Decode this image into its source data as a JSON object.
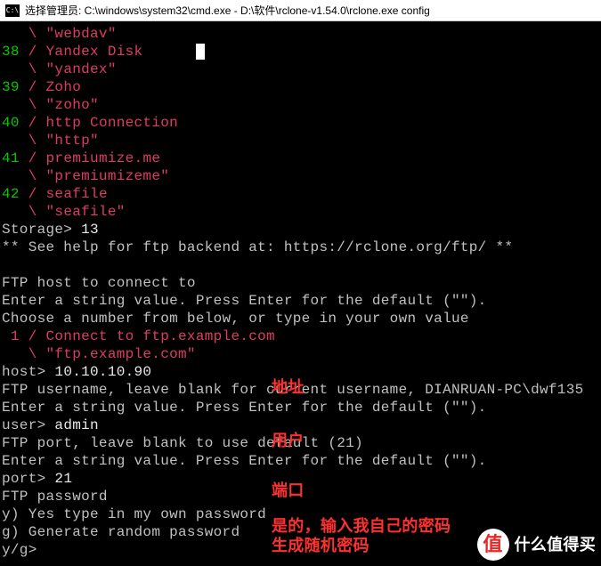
{
  "window": {
    "title": "选择管理员: C:\\windows\\system32\\cmd.exe - D:\\软件\\rclone-v1.54.0\\rclone.exe  config"
  },
  "items": [
    {
      "index": "  ",
      "name": "",
      "key": "webdav"
    },
    {
      "index": "38",
      "name": "Yandex Disk",
      "key": "yandex"
    },
    {
      "index": "39",
      "name": "Zoho",
      "key": "zoho"
    },
    {
      "index": "40",
      "name": "http Connection",
      "key": "http"
    },
    {
      "index": "41",
      "name": "premiumize.me",
      "key": "premiumizeme"
    },
    {
      "index": "42",
      "name": "seafile",
      "key": "seafile"
    }
  ],
  "prompts": {
    "storage_label": "Storage> ",
    "storage_value": "13",
    "help_line": "** See help for ftp backend at: https://rclone.org/ftp/ **",
    "host_header": "FTP host to connect to",
    "enter_string": "Enter a string value. Press Enter for the default (\"\").",
    "choose_num": "Choose a number from below, or type in your own value",
    "example_connect": " 1 / Connect to ftp.example.com",
    "example_key": "   \\ \"ftp.example.com\"",
    "host_label": "host> ",
    "host_value": "10.10.10.90",
    "user_line": "FTP username, leave blank for current username, DIANRUAN-PC\\dwf135",
    "user_label": "user> ",
    "user_value": "admin",
    "port_line": "FTP port, leave blank to use default (21)",
    "port_label": "port> ",
    "port_value": "21",
    "pass_header": "FTP password",
    "opt_y": "y) Yes type in my own password",
    "opt_g": "g) Generate random password",
    "yg_prompt": "y/g>"
  },
  "annotations": {
    "addr": "地址",
    "user": "用户",
    "port": "端口",
    "opt_y": "是的，输入我自己的密码",
    "opt_g": "生成随机密码"
  },
  "watermark": {
    "badge": "值",
    "text": "什么值得买"
  }
}
